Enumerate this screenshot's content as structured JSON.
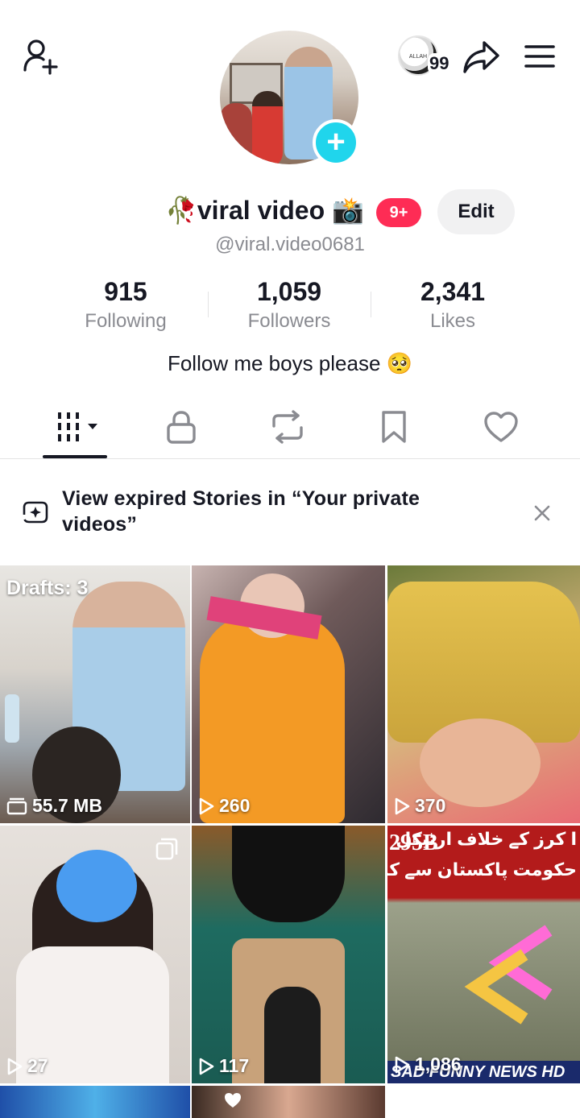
{
  "header": {
    "notification_count": "99",
    "mini_avatar_text": "ALLAH"
  },
  "profile": {
    "display_name": "🥀viral video 📸",
    "badge": "9+",
    "edit_label": "Edit",
    "handle": "@viral.video0681",
    "bio": "Follow me boys please 🥺"
  },
  "stats": [
    {
      "value": "915",
      "label": "Following"
    },
    {
      "value": "1,059",
      "label": "Followers"
    },
    {
      "value": "2,341",
      "label": "Likes"
    }
  ],
  "tabs": [
    "videos",
    "private",
    "reposts",
    "favorites",
    "liked"
  ],
  "banner": {
    "text": "View expired Stories in “Your private videos”"
  },
  "grid": [
    {
      "top_label": "Drafts: 3",
      "count": "55.7 MB",
      "count_icon": "drafts-icon"
    },
    {
      "count": "260",
      "count_icon": "play-icon"
    },
    {
      "count": "370",
      "count_icon": "play-icon"
    },
    {
      "count": "27",
      "count_icon": "play-icon"
    },
    {
      "count": "117",
      "count_icon": "play-icon"
    },
    {
      "count": "1,086",
      "count_icon": "play-icon",
      "headline": "295B",
      "urdu_line1": "ا کرز کے خلاف ارٹیکل",
      "urdu_line2": "حکومت پاکستان سے کاروائی کا م",
      "watermark": "SAD FUNNY NEWS HD"
    }
  ],
  "colors": {
    "accent_cyan": "#20d5ec",
    "badge_red": "#fe2c55",
    "text_primary": "#161823",
    "text_secondary": "#8a8b91"
  }
}
